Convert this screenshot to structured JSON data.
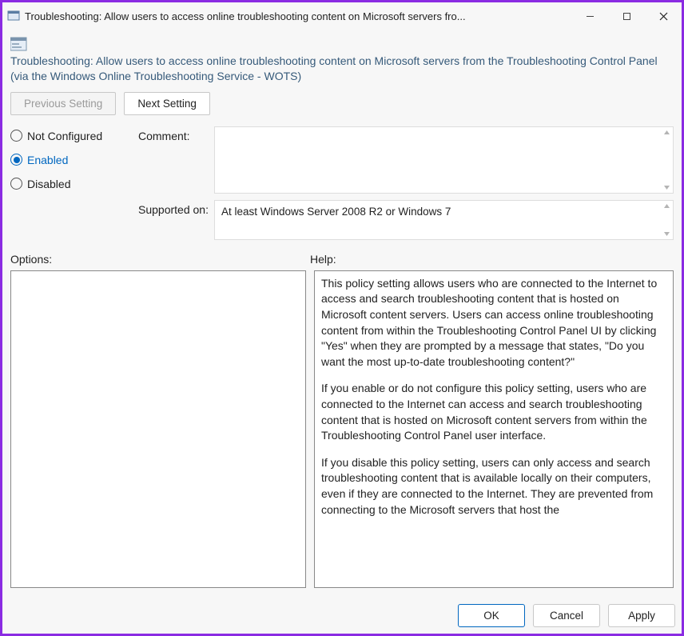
{
  "window": {
    "title": "Troubleshooting: Allow users to access online troubleshooting content on Microsoft servers fro..."
  },
  "policy": {
    "title": "Troubleshooting: Allow users to access online troubleshooting content on Microsoft servers from the Troubleshooting Control Panel (via the Windows Online Troubleshooting Service - WOTS)"
  },
  "nav": {
    "previous": "Previous Setting",
    "next": "Next Setting"
  },
  "radios": {
    "not_configured": "Not Configured",
    "enabled": "Enabled",
    "disabled": "Disabled",
    "selected": "enabled"
  },
  "fields": {
    "comment_label": "Comment:",
    "comment_value": "",
    "supported_label": "Supported on:",
    "supported_value": "At least Windows Server 2008 R2 or Windows 7"
  },
  "panes": {
    "options_label": "Options:",
    "help_label": "Help:",
    "options_body": "",
    "help_p1": "This policy setting allows users who are connected to the Internet to access and search troubleshooting content that is hosted on Microsoft content servers. Users can access online troubleshooting content from within the Troubleshooting Control Panel UI by clicking \"Yes\" when they are prompted by a message that states, \"Do you want the most up-to-date troubleshooting content?\"",
    "help_p2": "If you enable or do not configure this policy setting, users who are connected to the Internet can access and search troubleshooting content that is hosted on Microsoft content servers from within the Troubleshooting Control Panel user interface.",
    "help_p3": "If you disable this policy setting, users can only access and search troubleshooting content that is available locally on their computers, even if they are connected to the Internet. They are prevented from connecting to the Microsoft servers that host the"
  },
  "footer": {
    "ok": "OK",
    "cancel": "Cancel",
    "apply": "Apply"
  }
}
